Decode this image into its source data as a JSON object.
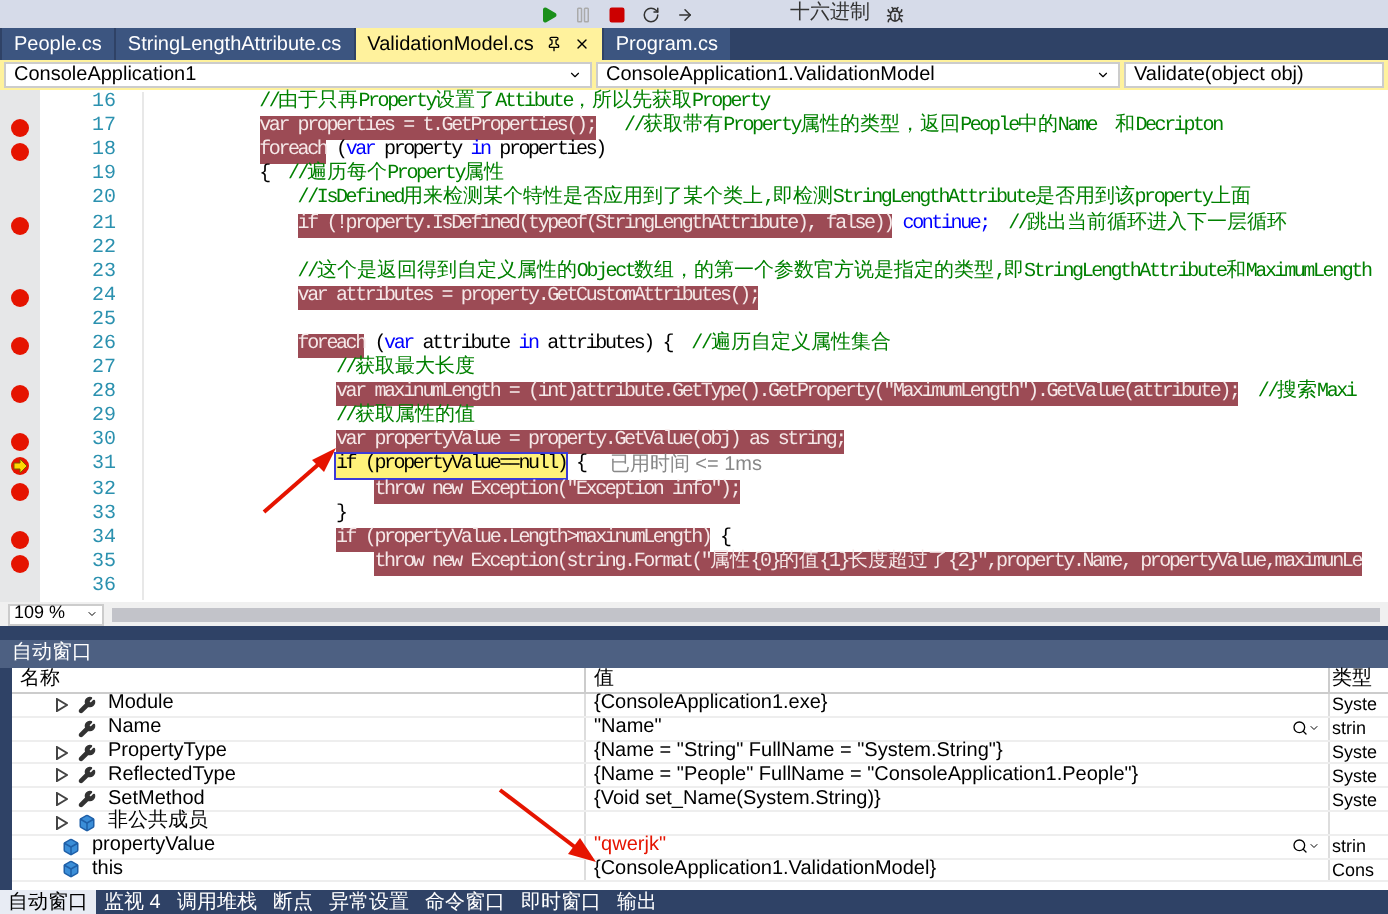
{
  "toolbar": {
    "hex_button": "十六进制"
  },
  "tabs": [
    {
      "label": "People.cs",
      "selected": false
    },
    {
      "label": "StringLengthAttribute.cs",
      "selected": false
    },
    {
      "label": "ValidationModel.cs",
      "selected": true
    },
    {
      "label": "Program.cs",
      "selected": false
    }
  ],
  "nav": {
    "project": "ConsoleApplication1",
    "class": "ConsoleApplication1.ValidationModel",
    "member": "Validate(object obj)"
  },
  "code_lines": [
    {
      "number": "16",
      "breakpoint": false,
      "current": false,
      "segments": [
        {
          "text": "//由于只再Property设置了Attibute，所以先获取Property",
          "kind": "comment"
        }
      ]
    },
    {
      "number": "17",
      "breakpoint": true,
      "current": false,
      "segments": [
        {
          "text": "var properties = t.GetProperties();",
          "kind": "hl"
        },
        {
          "text": "   //获取带有Property属性的类型，返回People中的Name  和Decripton",
          "kind": "comment"
        }
      ]
    },
    {
      "number": "18",
      "breakpoint": true,
      "current": false,
      "segments": [
        {
          "text": "foreach",
          "kind": "hl"
        },
        {
          "text": " (",
          "kind": "plain"
        },
        {
          "text": "var",
          "kind": "kw"
        },
        {
          "text": " property ",
          "kind": "plain"
        },
        {
          "text": "in",
          "kind": "kw"
        },
        {
          "text": " properties)",
          "kind": "plain"
        }
      ]
    },
    {
      "number": "19",
      "breakpoint": false,
      "current": false,
      "segments": [
        {
          "text": "{  ",
          "kind": "plain"
        },
        {
          "text": "//遍历每个Property属性",
          "kind": "comment"
        }
      ],
      "children": [
        {
          "number": "20",
          "breakpoint": false,
          "current": false,
          "segments": [
            {
              "text": "//IsDefined用来检测某个特性是否应用到了某个类上,即检测StringLengthAttribute是否用到该property上面",
              "kind": "comment"
            }
          ]
        },
        {
          "number": "21",
          "breakpoint": true,
          "current": false,
          "segments": [
            {
              "text": "if (!property.IsDefined(typeof(StringLengthAttribute), false))",
              "kind": "hl"
            },
            {
              "text": " continue;",
              "kind": "kw"
            },
            {
              "text": "  //跳出当前循环进入下一层循环",
              "kind": "comment"
            }
          ]
        },
        {
          "number": "22",
          "breakpoint": false,
          "current": false
        },
        {
          "number": "23",
          "breakpoint": false,
          "current": false,
          "segments": [
            {
              "text": "//这个是返回得到自定义属性的Object数组，的第一个参数官方说是指定的类型,即StringLengthAttribute和MaximumLength",
              "kind": "comment"
            }
          ]
        },
        {
          "number": "24",
          "breakpoint": true,
          "current": false,
          "segments": [
            {
              "text": "var attributes = property.GetCustomAttributes();",
              "kind": "hl"
            }
          ]
        },
        {
          "number": "25",
          "breakpoint": false,
          "current": false
        },
        {
          "number": "26",
          "breakpoint": true,
          "current": false,
          "segments": [
            {
              "text": "foreach",
              "kind": "hl"
            },
            {
              "text": " (",
              "kind": "plain"
            },
            {
              "text": "var",
              "kind": "kw"
            },
            {
              "text": " attribute ",
              "kind": "plain"
            },
            {
              "text": "in",
              "kind": "kw"
            },
            {
              "text": " attributes) {  ",
              "kind": "plain"
            },
            {
              "text": "//遍历自定义属性集合",
              "kind": "comment"
            }
          ],
          "children": [
            {
              "number": "27",
              "breakpoint": false,
              "current": false,
              "segments": [
                {
                  "text": "//获取最大长度",
                  "kind": "comment"
                }
              ]
            },
            {
              "number": "28",
              "breakpoint": true,
              "current": false,
              "segments": [
                {
                  "text": "var maxinumLength = (int)attribute.GetType().GetProperty(\"MaximumLength\").GetValue(attribute);",
                  "kind": "hl"
                },
                {
                  "text": "  //搜索Maxi",
                  "kind": "comment"
                }
              ]
            },
            {
              "number": "29",
              "breakpoint": false,
              "current": false,
              "segments": [
                {
                  "text": "//获取属性的值",
                  "kind": "comment"
                }
              ]
            },
            {
              "number": "30",
              "breakpoint": true,
              "current": false,
              "segments": [
                {
                  "text": "var propertyValue = property.GetValue(obj) as string;",
                  "kind": "hl"
                }
              ]
            },
            {
              "number": "31",
              "breakpoint": true,
              "current": true,
              "segments": [
                {
                  "text": "if (propertyValue==null)",
                  "kind": "current"
                },
                {
                  "text": " {",
                  "kind": "plain"
                },
                {
                  "text": "已用时间 <= 1ms",
                  "kind": "hint"
                }
              ],
              "children": [
                {
                  "number": "32",
                  "breakpoint": true,
                  "current": false,
                  "segments": [
                    {
                      "text": "throw new Exception(\"Exception info\");",
                      "kind": "hl"
                    }
                  ]
                }
              ]
            },
            {
              "number": "33",
              "breakpoint": false,
              "current": false,
              "segments": [
                {
                  "text": "}",
                  "kind": "plain"
                }
              ]
            },
            {
              "number": "34",
              "breakpoint": true,
              "current": false,
              "segments": [
                {
                  "text": "if (propertyValue.Length>maxinumLength)",
                  "kind": "hl"
                },
                {
                  "text": " {",
                  "kind": "plain"
                }
              ],
              "children": [
                {
                  "number": "35",
                  "breakpoint": true,
                  "current": false,
                  "segments": [
                    {
                      "text": "throw new Exception(string.Format(\"属性{0}的值{1}长度超过了{2}\",property.Name, propertyValue,maximunLe",
                      "kind": "hl"
                    }
                  ]
                }
              ]
            },
            {
              "number": "36",
              "breakpoint": false,
              "current": false
            }
          ]
        }
      ]
    }
  ],
  "zoom": "109 %",
  "auto_window": {
    "title": "自动窗口",
    "columns": [
      "名称",
      "值",
      "类型"
    ],
    "rows": [
      {
        "children": [
          {
            "name": "Module",
            "value": "{ConsoleApplication1.exe}",
            "type": "Syste",
            "kind": "property",
            "expandable": true,
            "changed": false,
            "visualizer": false
          },
          {
            "name": "Name",
            "value": "\"Name\"",
            "type": "strin",
            "kind": "property",
            "expandable": false,
            "changed": false,
            "visualizer": true
          },
          {
            "name": "PropertyType",
            "value": "{Name = \"String\" FullName = \"System.String\"}",
            "type": "Syste",
            "kind": "property",
            "expandable": true,
            "changed": false,
            "visualizer": false
          },
          {
            "name": "ReflectedType",
            "value": "{Name = \"People\" FullName = \"ConsoleApplication1.People\"}",
            "type": "Syste",
            "kind": "property",
            "expandable": true,
            "changed": false,
            "visualizer": false
          },
          {
            "name": "SetMethod",
            "value": "{Void set_Name(System.String)}",
            "type": "Syste",
            "kind": "property",
            "expandable": true,
            "changed": false,
            "visualizer": false
          },
          {
            "name": "非公共成员",
            "kind": "field",
            "expandable": true,
            "changed": false,
            "visualizer": false
          }
        ]
      },
      {
        "name": "propertyValue",
        "value": "\"qwerjk\"",
        "type": "strin",
        "kind": "field",
        "expandable": false,
        "changed": true,
        "visualizer": true
      },
      {
        "name": "this",
        "value": "{ConsoleApplication1.ValidationModel}",
        "type": "Cons",
        "kind": "field",
        "expandable": false,
        "changed": false,
        "visualizer": false
      }
    ]
  },
  "bottom_tabs": [
    {
      "label": "自动窗口",
      "selected": true
    },
    {
      "label": "监视 4",
      "selected": false
    },
    {
      "label": "调用堆栈",
      "selected": false
    },
    {
      "label": "断点",
      "selected": false
    },
    {
      "label": "异常设置",
      "selected": false
    },
    {
      "label": "命令窗口",
      "selected": false
    },
    {
      "label": "即时窗口",
      "selected": false
    },
    {
      "label": "输出",
      "selected": false
    }
  ]
}
